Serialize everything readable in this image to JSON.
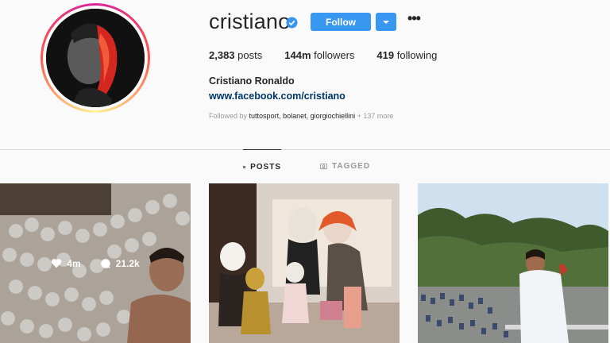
{
  "profile": {
    "username": "cristiano",
    "full_name": "Cristiano Ronaldo",
    "website": "www.facebook.com/cristiano",
    "verified": true
  },
  "actions": {
    "follow_label": "Follow"
  },
  "stats": {
    "posts_count": "2,383",
    "posts_label": "posts",
    "followers_count": "144m",
    "followers_label": "followers",
    "following_count": "419",
    "following_label": "following"
  },
  "followed_by": {
    "prefix": "Followed by",
    "names": "tuttosport, bolanet, giorgiochiellini",
    "more": "+ 137 more"
  },
  "tabs": [
    {
      "label": "POSTS",
      "icon": "grid-icon",
      "active": true
    },
    {
      "label": "TAGGED",
      "icon": "tagged-icon",
      "active": false
    }
  ],
  "posts": [
    {
      "likes": "4m",
      "comments": "21.2k",
      "description": "ball pit photo"
    },
    {
      "description": "family halloween costumes"
    },
    {
      "description": "man on stadium balcony"
    }
  ],
  "colors": {
    "accent": "#3897f0",
    "link": "#003569",
    "muted": "#999999"
  }
}
